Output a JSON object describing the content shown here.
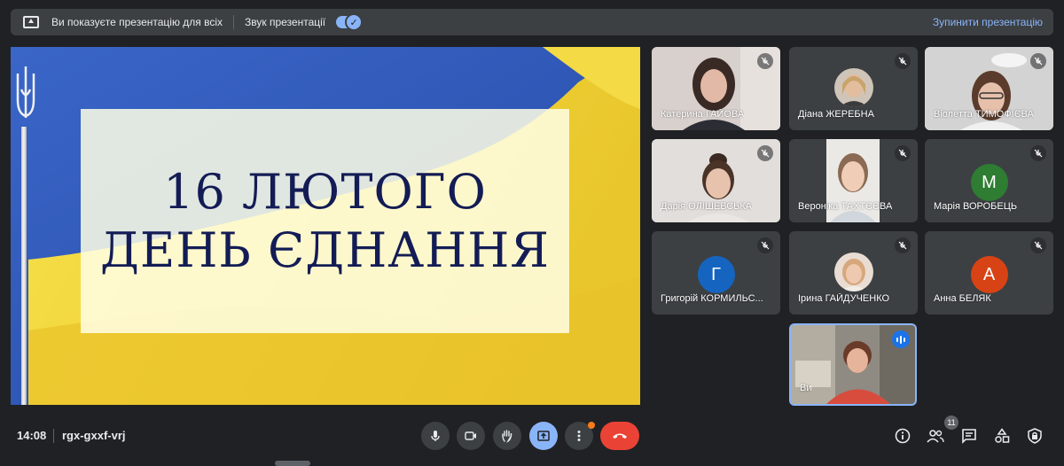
{
  "topbar": {
    "presenting_msg": "Ви показуєте презентацію для всіх",
    "sound_label": "Звук презентації",
    "sound_on": true,
    "stop_label": "Зупинити презентацію"
  },
  "slide": {
    "line1": "16 ЛЮТОГО",
    "line2": "ДЕНЬ ЄДНАННЯ",
    "colors": {
      "blue": "#2f57b8",
      "yellow": "#f2d43a",
      "text": "#131c55"
    }
  },
  "participants": [
    {
      "name": "Катерина ГАЙОВА",
      "type": "video",
      "muted": true
    },
    {
      "name": "Діана ЖЕРЕБНА",
      "type": "photo",
      "muted": true
    },
    {
      "name": "Віолетта ТИМОФІЄВА",
      "type": "video",
      "muted": true
    },
    {
      "name": "Дарія ОЛІШЕВСЬКА",
      "type": "video",
      "muted": true
    },
    {
      "name": "Вероніка ТАХТЄЄВА",
      "type": "video",
      "muted": true
    },
    {
      "name": "Марія ВОРОБЕЦЬ",
      "type": "letter",
      "letter": "М",
      "color": "#2e7d32",
      "muted": true
    },
    {
      "name": "Григорій КОРМИЛЬС...",
      "type": "letter",
      "letter": "Г",
      "color": "#1565c0",
      "muted": true
    },
    {
      "name": "Ірина ГАЙДУЧЕНКО",
      "type": "photo",
      "muted": true
    },
    {
      "name": "Анна БЕЛЯК",
      "type": "letter",
      "letter": "А",
      "color": "#d84315",
      "muted": true
    },
    {
      "name": "Ви",
      "type": "video",
      "muted": false,
      "speaking": true
    }
  ],
  "bottombar": {
    "time": "14:08",
    "meeting_code": "rgx-gxxf-vrj",
    "people_count": "11"
  },
  "icons": {
    "mic": "mic-icon",
    "camera": "camera-icon",
    "hand": "raise-hand-icon",
    "present": "present-icon",
    "more": "more-vert-icon",
    "end": "call-end-icon",
    "info": "info-icon",
    "people": "people-icon",
    "chat": "chat-icon",
    "activities": "activities-icon",
    "lock": "lock-icon"
  }
}
